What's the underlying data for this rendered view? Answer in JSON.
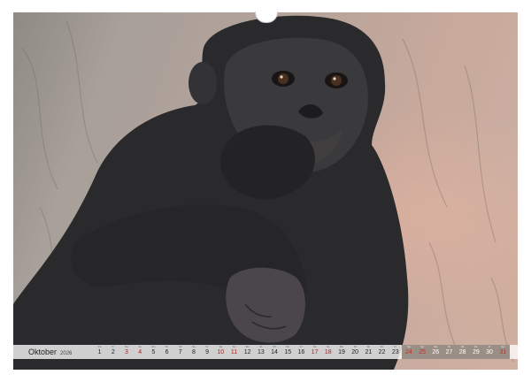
{
  "calendar": {
    "month": "Oktober",
    "year": "2026",
    "days": [
      {
        "num": "1",
        "dow": "Do",
        "holiday": false,
        "shaded": false
      },
      {
        "num": "2",
        "dow": "Fr",
        "holiday": false,
        "shaded": false
      },
      {
        "num": "3",
        "dow": "Sa",
        "holiday": true,
        "shaded": false
      },
      {
        "num": "4",
        "dow": "So",
        "holiday": true,
        "shaded": false
      },
      {
        "num": "5",
        "dow": "Mo",
        "holiday": false,
        "shaded": false
      },
      {
        "num": "6",
        "dow": "Di",
        "holiday": false,
        "shaded": false
      },
      {
        "num": "7",
        "dow": "Mi",
        "holiday": false,
        "shaded": false
      },
      {
        "num": "8",
        "dow": "Do",
        "holiday": false,
        "shaded": false
      },
      {
        "num": "9",
        "dow": "Fr",
        "holiday": false,
        "shaded": false
      },
      {
        "num": "10",
        "dow": "Sa",
        "holiday": true,
        "shaded": false
      },
      {
        "num": "11",
        "dow": "So",
        "holiday": true,
        "shaded": false
      },
      {
        "num": "12",
        "dow": "Mo",
        "holiday": false,
        "shaded": false
      },
      {
        "num": "13",
        "dow": "Di",
        "holiday": false,
        "shaded": false
      },
      {
        "num": "14",
        "dow": "Mi",
        "holiday": false,
        "shaded": false
      },
      {
        "num": "15",
        "dow": "Do",
        "holiday": false,
        "shaded": false
      },
      {
        "num": "16",
        "dow": "Fr",
        "holiday": false,
        "shaded": false
      },
      {
        "num": "17",
        "dow": "Sa",
        "holiday": true,
        "shaded": false
      },
      {
        "num": "18",
        "dow": "So",
        "holiday": true,
        "shaded": false
      },
      {
        "num": "19",
        "dow": "Mo",
        "holiday": false,
        "shaded": false
      },
      {
        "num": "20",
        "dow": "Di",
        "holiday": false,
        "shaded": false
      },
      {
        "num": "21",
        "dow": "Mi",
        "holiday": false,
        "shaded": false
      },
      {
        "num": "22",
        "dow": "Do",
        "holiday": false,
        "shaded": false
      },
      {
        "num": "23",
        "dow": "Fr",
        "holiday": false,
        "shaded": false
      },
      {
        "num": "24",
        "dow": "Sa",
        "holiday": true,
        "shaded": true
      },
      {
        "num": "25",
        "dow": "So",
        "holiday": true,
        "shaded": true
      },
      {
        "num": "26",
        "dow": "Mo",
        "holiday": false,
        "shaded": true
      },
      {
        "num": "27",
        "dow": "Di",
        "holiday": false,
        "shaded": true
      },
      {
        "num": "28",
        "dow": "Mi",
        "holiday": false,
        "shaded": true
      },
      {
        "num": "29",
        "dow": "Do",
        "holiday": false,
        "shaded": true
      },
      {
        "num": "30",
        "dow": "Fr",
        "holiday": false,
        "shaded": true
      },
      {
        "num": "31",
        "dow": "Sa",
        "holiday": true,
        "shaded": true
      }
    ]
  },
  "colors": {
    "holiday": "#b0221c",
    "shaded_cell": "#9a8f86",
    "fur": "#2a2a2d"
  }
}
